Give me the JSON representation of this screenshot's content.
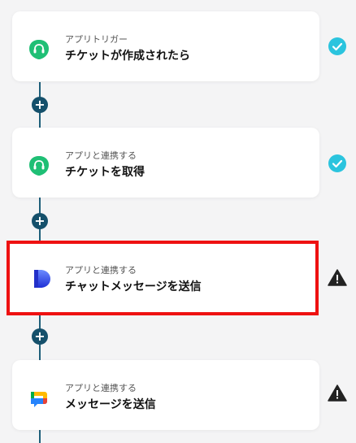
{
  "steps": [
    {
      "type_label": "アプリトリガー",
      "title": "チケットが作成されたら",
      "icon": "headset-icon",
      "status": "success"
    },
    {
      "type_label": "アプリと連携する",
      "title": "チケットを取得",
      "icon": "headset-icon",
      "status": "success"
    },
    {
      "type_label": "アプリと連携する",
      "title": "チャットメッセージを送信",
      "icon": "dialpad-icon",
      "status": "warning",
      "selected": true
    },
    {
      "type_label": "アプリと連携する",
      "title": "メッセージを送信",
      "icon": "google-chat-icon",
      "status": "warning"
    }
  ],
  "colors": {
    "success": "#2bc4de",
    "warning": "#222222",
    "connector": "#15506b",
    "highlight": "#ee1111"
  }
}
